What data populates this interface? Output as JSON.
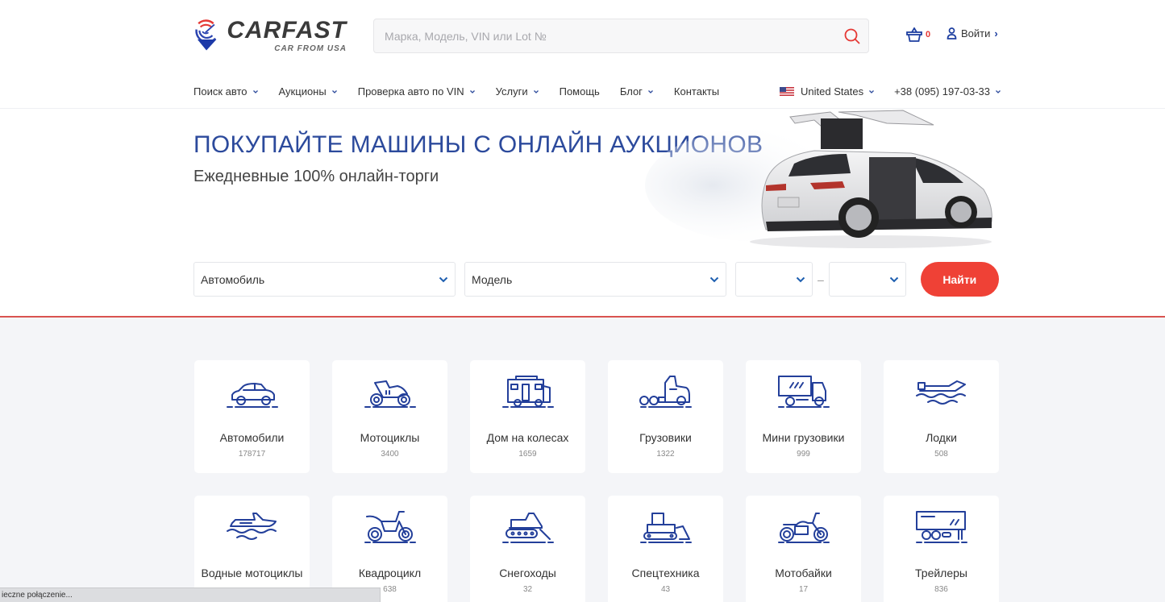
{
  "header": {
    "logo_title": "CARFAST",
    "logo_subtitle": "CAR FROM USA",
    "search_placeholder": "Марка, Модель, VIN или Lot №",
    "search_value": "",
    "cart_count": "0",
    "login_label": "Войти"
  },
  "nav": {
    "items": [
      {
        "label": "Поиск авто",
        "dropdown": true
      },
      {
        "label": "Аукционы",
        "dropdown": true
      },
      {
        "label": "Проверка авто по VIN",
        "dropdown": true
      },
      {
        "label": "Услуги",
        "dropdown": true
      },
      {
        "label": "Помощь",
        "dropdown": false
      },
      {
        "label": "Блог",
        "dropdown": true
      },
      {
        "label": "Контакты",
        "dropdown": false
      }
    ],
    "region": "United States",
    "phone": "+38 (095) 197-03-33"
  },
  "hero": {
    "title": "ПОКУПАЙТЕ МАШИНЫ С ОНЛАЙН АУКЦИОНОВ",
    "subtitle": "Ежедневные 100% онлайн-торги"
  },
  "filters": {
    "vehicle_type": "Автомобиль",
    "model": "Модель",
    "year_from": "",
    "year_to": "",
    "range_separator": "–",
    "submit_label": "Найти"
  },
  "categories": [
    {
      "name": "Автомобили",
      "count": "178717",
      "icon": "car-icon"
    },
    {
      "name": "Мотоциклы",
      "count": "3400",
      "icon": "sport-motorcycle-icon"
    },
    {
      "name": "Дом на колесах",
      "count": "1659",
      "icon": "rv-icon"
    },
    {
      "name": "Грузовики",
      "count": "1322",
      "icon": "semi-truck-icon"
    },
    {
      "name": "Мини грузовики",
      "count": "999",
      "icon": "box-truck-icon"
    },
    {
      "name": "Лодки",
      "count": "508",
      "icon": "boat-icon"
    },
    {
      "name": "Водные мотоциклы",
      "count": "",
      "icon": "jetski-icon"
    },
    {
      "name": "Квадроцикл",
      "count": "638",
      "icon": "dirt-bike-icon"
    },
    {
      "name": "Снегоходы",
      "count": "32",
      "icon": "snowmobile-icon"
    },
    {
      "name": "Спецтехника",
      "count": "43",
      "icon": "bulldozer-icon"
    },
    {
      "name": "Мотобайки",
      "count": "17",
      "icon": "cruiser-motorcycle-icon"
    },
    {
      "name": "Трейлеры",
      "count": "836",
      "icon": "trailer-icon"
    }
  ],
  "status_bar": {
    "text": "ieczne połączenie..."
  },
  "colors": {
    "brand_blue": "#2c4a9c",
    "accent_red": "#ef4136",
    "icon_blue": "#233f9a"
  }
}
